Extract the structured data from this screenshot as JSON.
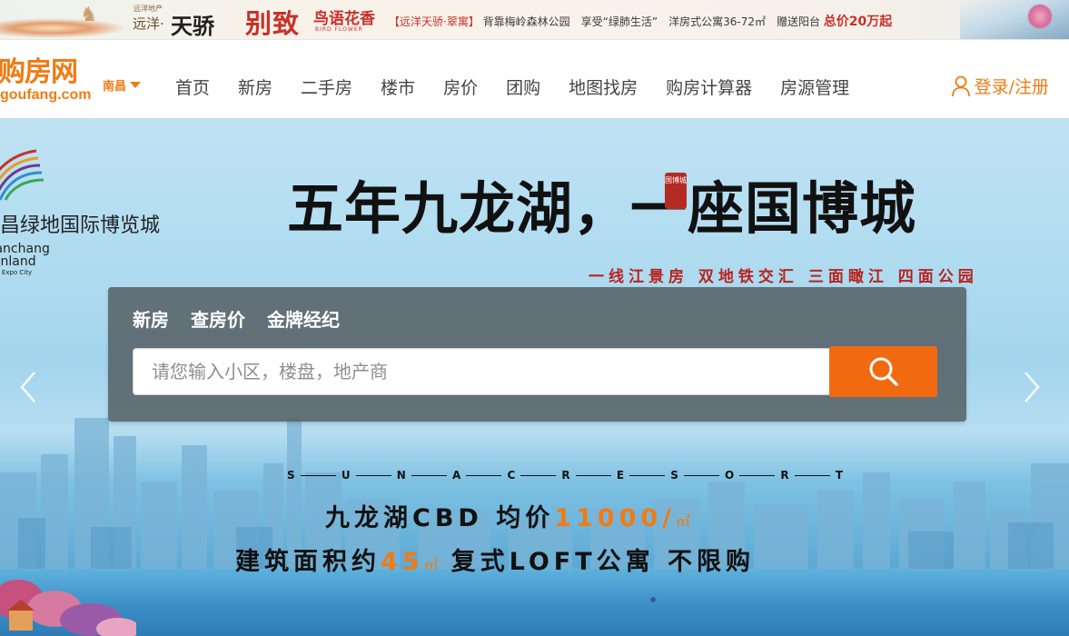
{
  "promo": {
    "dev_label": "远洋地产",
    "brand_a": "远洋·",
    "brand_b": "天骄",
    "bie_zhi": "别致",
    "niao_yu": "鸟语花香",
    "bird_flower": "BIRD FLOWER",
    "ad_text_1": "【远洋天骄·翠寓】",
    "ad_text_2": "背靠梅岭森林公园　享受“绿肺生活”　洋房式公寓36-72㎡　赠送阳台",
    "ad_price": "总价20万起"
  },
  "header": {
    "logo_cn": "购房网",
    "logo_en": "goufang.com",
    "city": "南昌",
    "menu": [
      "首页",
      "新房",
      "二手房",
      "楼市",
      "房价",
      "团购",
      "地图找房",
      "购房计算器",
      "房源管理"
    ],
    "login": "登录/注册"
  },
  "hero": {
    "expo_cn": "南昌绿地国际博览城",
    "expo_en_1": "Nanchang",
    "expo_en_2": "Greenland",
    "expo_en_3": "International Expo City",
    "headline": "五年九龙湖，一座国博城",
    "seal_text": "国博城",
    "slogan": "一线江景房 双地铁交汇 三面瞰江 四面公园",
    "resort_letters": [
      "S",
      "U",
      "N",
      "A",
      "C",
      "R",
      "E",
      "S",
      "O",
      "R",
      "T"
    ],
    "price_prefix": "九龙湖CBD 均价",
    "price_value": "11000/",
    "price_unit": "㎡",
    "area_prefix": "建筑面积约",
    "area_value": "45",
    "area_unit": "㎡",
    "area_suffix": "复式LOFT公寓 不限购"
  },
  "search": {
    "tabs": [
      "新房",
      "查房价",
      "金牌经纪"
    ],
    "placeholder": "请您输入小区，楼盘，地产商"
  },
  "colors": {
    "brand_orange": "#f07b14",
    "search_button": "#f26a10",
    "slogan_red": "#b8231d",
    "panel_gray": "#586268"
  }
}
